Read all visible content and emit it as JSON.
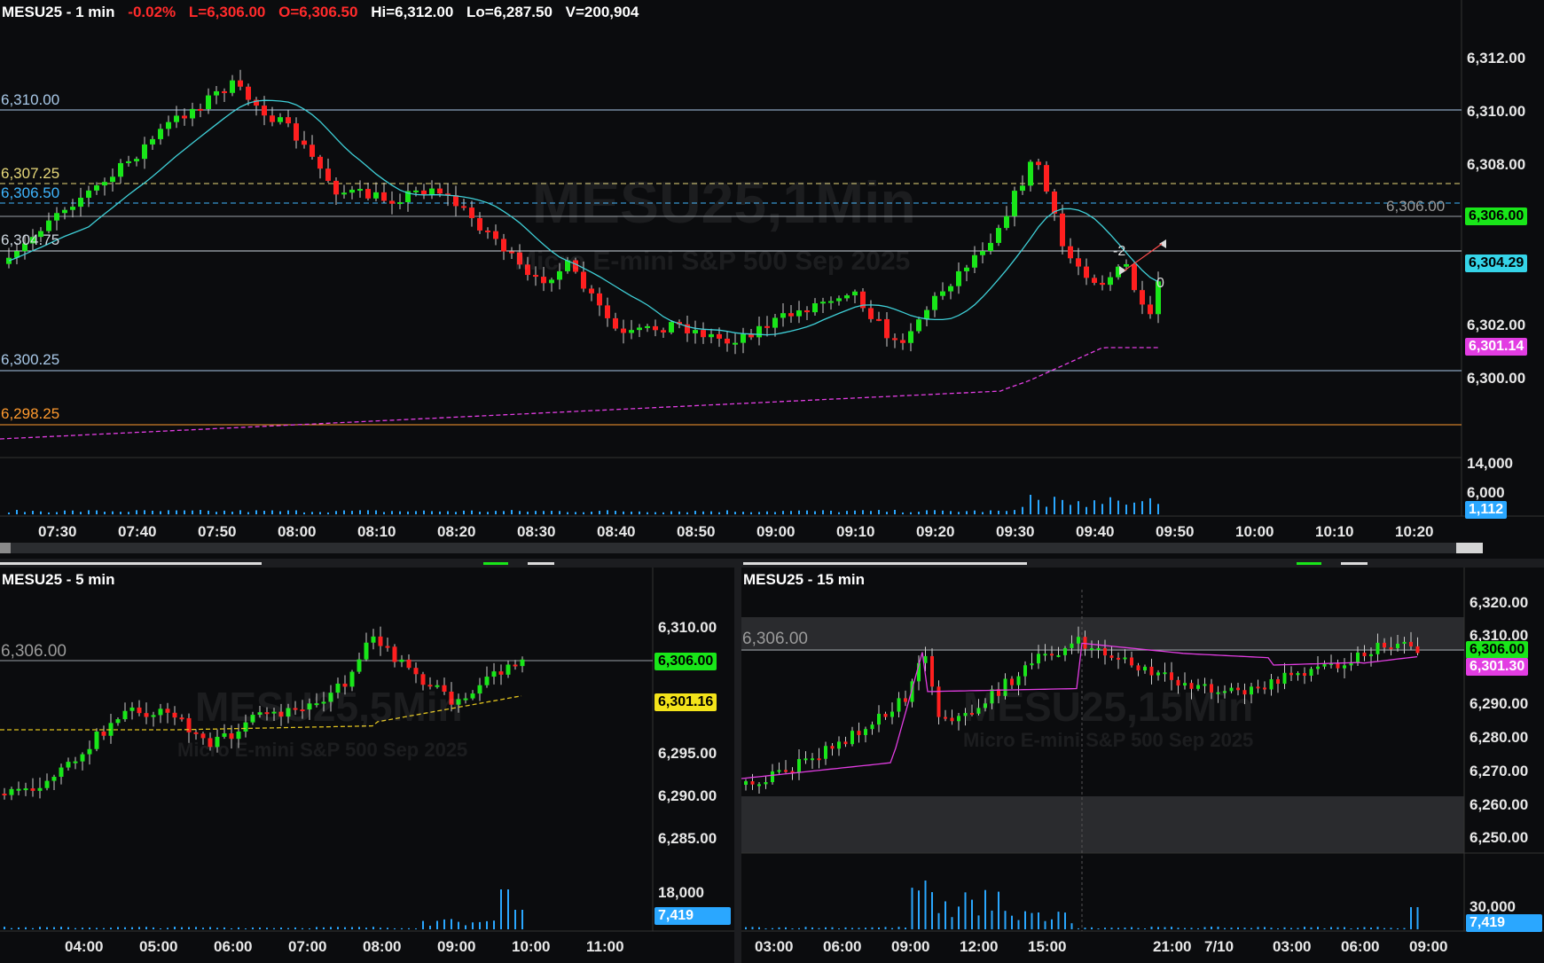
{
  "top": {
    "symbol_interval": "MESU25 - 1 min",
    "change_pct": "-0.02%",
    "last": "L=6,306.00",
    "open": "O=6,306.50",
    "high": "Hi=6,312.00",
    "low": "Lo=6,287.50",
    "volume": "V=200,904",
    "watermark_symbol": "MESU25,1Min",
    "watermark_desc": "Micro E-mini S&P 500 Sep 2025",
    "y_labels": [
      "6,312.00",
      "6,310.00",
      "6,308.00",
      "6,302.00",
      "6,300.00"
    ],
    "vol_labels": [
      "14,000",
      "6,000"
    ],
    "vol_tag": "1,112",
    "price_tag_last": "6,306.00",
    "price_tag_ema": "6,304.29",
    "price_tag_vwap": "6,301.14",
    "x_labels": [
      "07:30",
      "07:40",
      "07:50",
      "08:00",
      "08:10",
      "08:20",
      "08:30",
      "08:40",
      "08:50",
      "09:00",
      "09:10",
      "09:20",
      "09:30",
      "09:40",
      "09:50",
      "10:00",
      "10:10",
      "10:20"
    ],
    "levels": [
      {
        "label": "6,310.00",
        "color": "#a9c9e8"
      },
      {
        "label": "6,307.25",
        "color": "#e8d97a"
      },
      {
        "label": "6,306.50",
        "color": "#3fb6ff"
      },
      {
        "label": "6,304.75",
        "color": "#cfd8e0"
      },
      {
        "label": "6,300.25",
        "color": "#a9c9e8"
      },
      {
        "label": "6,298.25",
        "color": "#ff9a2e"
      }
    ],
    "right_level_label": "6,306.00",
    "marker_neg": "-2",
    "marker_zero": "0"
  },
  "bl": {
    "symbol_interval": "MESU25 - 5 min",
    "watermark_symbol": "MESU25,5Min",
    "watermark_desc": "Micro E-mini S&P 500 Sep 2025",
    "level_label": "6,306.00",
    "y_labels": [
      "6,310.00",
      "6,295.00",
      "6,290.00",
      "6,285.00"
    ],
    "price_tag_last": "6,306.00",
    "price_tag_ma": "6,301.16",
    "vol_label": "18,000",
    "vol_tag": "7,419",
    "x_labels": [
      "04:00",
      "05:00",
      "06:00",
      "07:00",
      "08:00",
      "09:00",
      "10:00",
      "11:00"
    ]
  },
  "br": {
    "symbol_interval": "MESU25 - 15 min",
    "watermark_symbol": "MESU25,15Min",
    "watermark_desc": "Micro E-mini S&P 500 Sep 2025",
    "level_label": "6,306.00",
    "y_labels": [
      "6,320.00",
      "6,310.00",
      "6,290.00",
      "6,280.00",
      "6,270.00",
      "6,260.00",
      "6,250.00"
    ],
    "price_tag_last": "6,306.00",
    "price_tag_vwap": "6,301.30",
    "vol_label": "30,000",
    "vol_tag": "7,419",
    "x_labels": [
      "03:00",
      "06:00",
      "09:00",
      "12:00",
      "15:00",
      "21:00",
      "7/10",
      "03:00",
      "06:00",
      "09:00"
    ]
  },
  "colors": {
    "up": "#19e619",
    "down": "#ff1f1f",
    "ema": "#3fd0d8",
    "vwap": "#e23de2",
    "ma_yellow": "#e0c21f",
    "last_tag": "#19e619",
    "ema_tag": "#35d4e8",
    "vwap_tag": "#e23de2",
    "vol_tag": "#2aa7ff",
    "yellow_tag": "#f3e31a"
  }
}
